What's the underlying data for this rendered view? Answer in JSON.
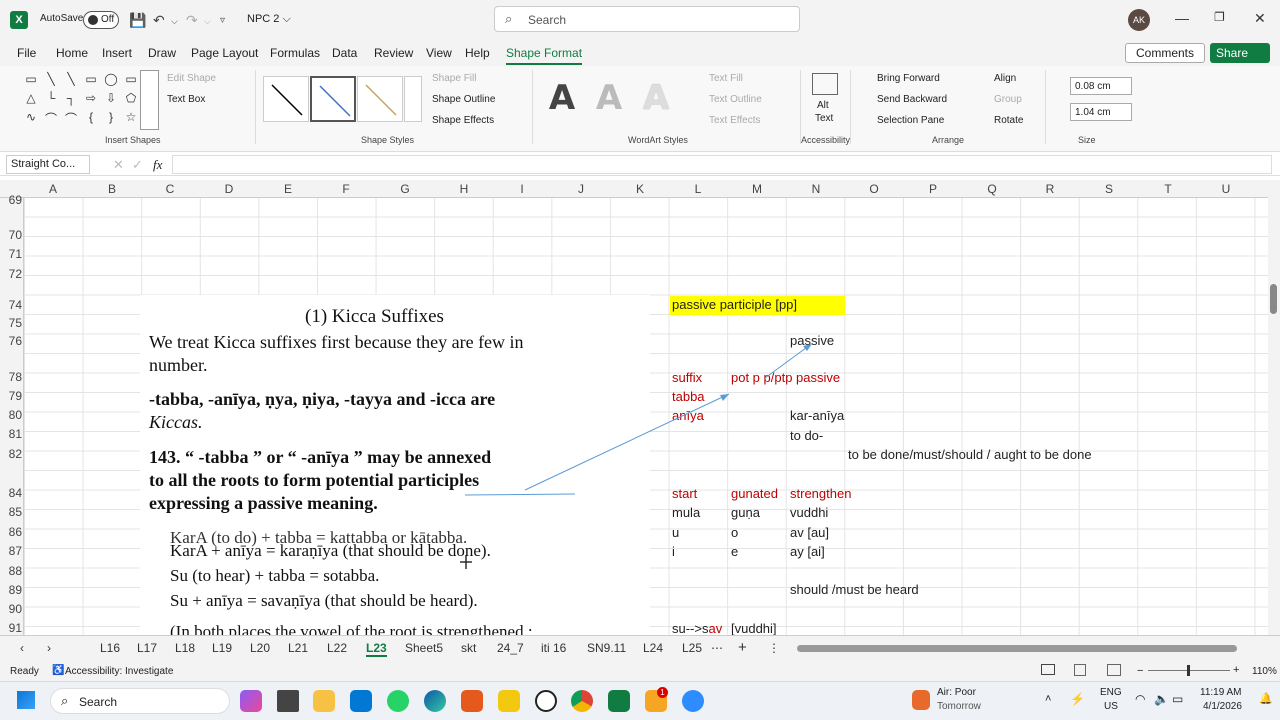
{
  "titlebar": {
    "autosave": "AutoSave",
    "toggle": "Off",
    "doc_name": "NPC 2 ⌵",
    "search_placeholder": "Search",
    "avatar": "AK"
  },
  "menu": {
    "items": [
      "File",
      "Home",
      "Insert",
      "Draw",
      "Page Layout",
      "Formulas",
      "Data",
      "Review",
      "View",
      "Help",
      "Shape Format"
    ],
    "comments": "Comments",
    "share": "Share"
  },
  "ribbon": {
    "edit_shape": "Edit Shape",
    "text_box": "Text Box",
    "insert_shapes": "Insert Shapes",
    "shape_fill": "Shape Fill",
    "shape_outline": "Shape Outline",
    "shape_effects": "Shape Effects",
    "shape_styles": "Shape Styles",
    "text_fill": "Text Fill",
    "text_outline": "Text Outline",
    "text_effects": "Text Effects",
    "wordart_styles": "WordArt Styles",
    "wordart_letter": "A",
    "alt_text_1": "Alt",
    "alt_text_2": "Text",
    "accessibility": "Accessibility",
    "bring_forward": "Bring Forward",
    "send_backward": "Send Backward",
    "selection_pane": "Selection Pane",
    "align": "Align",
    "group": "Group",
    "rotate": "Rotate",
    "arrange": "Arrange",
    "height": "0.08 cm",
    "width": "1.04 cm",
    "size": "Size"
  },
  "formula_bar": {
    "name_box": "Straight Co...",
    "fx": "fx",
    "value": ""
  },
  "columns": [
    "A",
    "B",
    "C",
    "D",
    "E",
    "F",
    "G",
    "H",
    "I",
    "J",
    "K",
    "L",
    "M",
    "N",
    "O",
    "P",
    "Q",
    "R",
    "S",
    "T",
    "U"
  ],
  "rows": [
    "69",
    "70",
    "71",
    "72",
    "74",
    "75",
    "76",
    "78",
    "79",
    "80",
    "81",
    "82",
    "84",
    "85",
    "86",
    "87",
    "88",
    "89",
    "90",
    "91"
  ],
  "cells": {
    "l74": "passive  participle [pp]",
    "n76": "passive",
    "l78": "suffix",
    "m78": "pot p p/ptp  passive",
    "l79": "tabba",
    "l80": "anīya",
    "n80": "kar-anīya",
    "n81": "to do-",
    "o82": "to be done/must/should / aught to be done",
    "l84": "start",
    "m84": "gunated",
    "n84": "strengthen",
    "l85": "mula",
    "m85": "guṇa",
    "n85": "vuddhi",
    "l86": "u",
    "m86": "o",
    "n86": "av [au]",
    "l87": "i",
    "m87": "e",
    "n87": "ay [ai]",
    "n89": "should /must be heard",
    "l91a": "su-->s",
    "l91b": "av",
    "m91": "[vuddhi]"
  },
  "book": {
    "heading": "(1)  Kicca Suffixes",
    "p1a": "We treat Kicca suffixes first because they are few in",
    "p1b": "number.",
    "p2a": "-tabba, -anīya, ṇya, ṇiya, -tayya and -icca are",
    "p2b": "Kiccas.",
    "p3a": "143.  “ -tabba ” or “ -anīya ” may be annexed",
    "p3b": "to all the roots to form potential participles",
    "p3c": "expressing a passive meaning.",
    "ex1": "KarA (to do) + tabba = kattabba or kātabba.",
    "ex2": "KarA + anīya = karaṇīya (that should be done).",
    "ex3": "Su (to hear) + tabba = sotabba.",
    "ex4": "Su + anīya = savaṇīya (that should be heard).",
    "ex5": "(In both places the vowel of the root is strengthened ;"
  },
  "sheet_tabs": [
    "L16",
    "L17",
    "L18",
    "L19",
    "L20",
    "L21",
    "L22",
    "L23",
    "Sheet5",
    "skt",
    "24_7",
    "iti 16",
    "SN9.11",
    "L24",
    "L25"
  ],
  "active_tab": "L23",
  "status": {
    "ready": "Ready",
    "accessibility": "Accessibility: Investigate",
    "zoom": "110%"
  },
  "taskbar": {
    "search": "Search",
    "weather_1": "Air: Poor",
    "weather_2": "Tomorrow",
    "lang_1": "ENG",
    "lang_2": "US",
    "time": "11:19 AM",
    "date": "4/1/2026",
    "badge": "1"
  }
}
